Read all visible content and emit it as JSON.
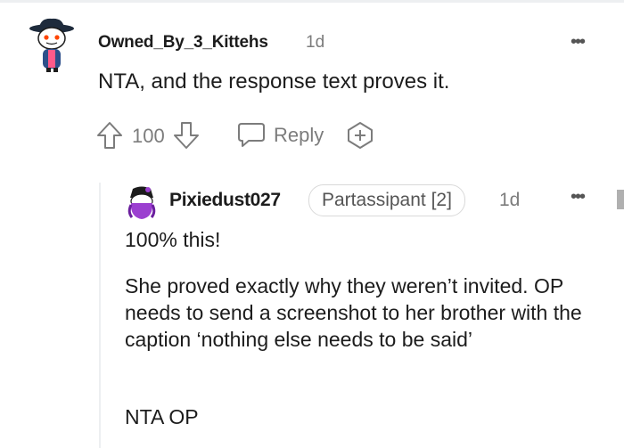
{
  "comment": {
    "author": "Owned_By_3_Kittehs",
    "time": "1d",
    "more": "•••",
    "body": "NTA, and the response text proves it.",
    "score": "100",
    "reply_label": "Reply"
  },
  "reply": {
    "author": "Pixiedust027",
    "flair": "Partassipant [2]",
    "time": "1d",
    "more": "•••",
    "paragraphs": [
      "100% this!",
      "She proved exactly why they weren’t invited. OP needs to send a screenshot to her brother with the caption ‘nothing else needs to be said’",
      "NTA OP"
    ]
  },
  "colors": {
    "meta_gray": "#7c7c7c",
    "thread_line": "#edeff1",
    "text": "#1c1c1c"
  },
  "icons": {
    "upvote": "arrow-up-icon",
    "downvote": "arrow-down-icon",
    "reply": "speech-bubble-icon",
    "award": "award-plus-icon",
    "more": "ellipsis-icon"
  }
}
